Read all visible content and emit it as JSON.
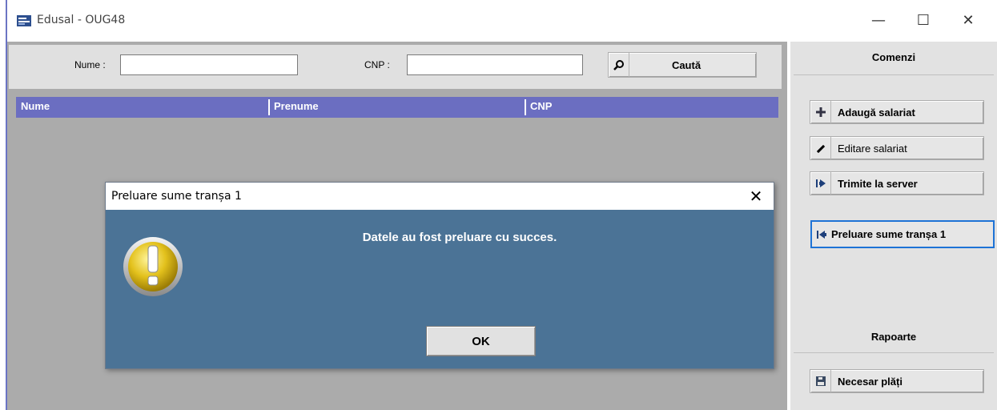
{
  "window": {
    "title": "Edusal - OUG48",
    "minimize": "—",
    "maximize": "☐",
    "close": "✕"
  },
  "search": {
    "name_label": "Nume :",
    "name_value": "",
    "cnp_label": "CNP :",
    "cnp_value": "",
    "search_button": "Caută"
  },
  "grid": {
    "columns": [
      "Nume",
      "Prenume",
      "CNP"
    ],
    "rows": []
  },
  "commands": {
    "header": "Comenzi",
    "add_employee": "Adaugă salariat",
    "edit_employee": "Editare salariat",
    "send_server": "Trimite la server",
    "fetch_tranche": "Preluare sume tranșa 1"
  },
  "reports": {
    "header": "Rapoarte",
    "payment_need": "Necesar plăți"
  },
  "dialog": {
    "title": "Preluare sume tranșa 1",
    "close": "✕",
    "message": "Datele au fost preluare cu succes.",
    "ok": "OK"
  },
  "colors": {
    "grid_header": "#6b6ec1",
    "dialog_body": "#4b7396",
    "focus_border": "#1e73d6"
  }
}
